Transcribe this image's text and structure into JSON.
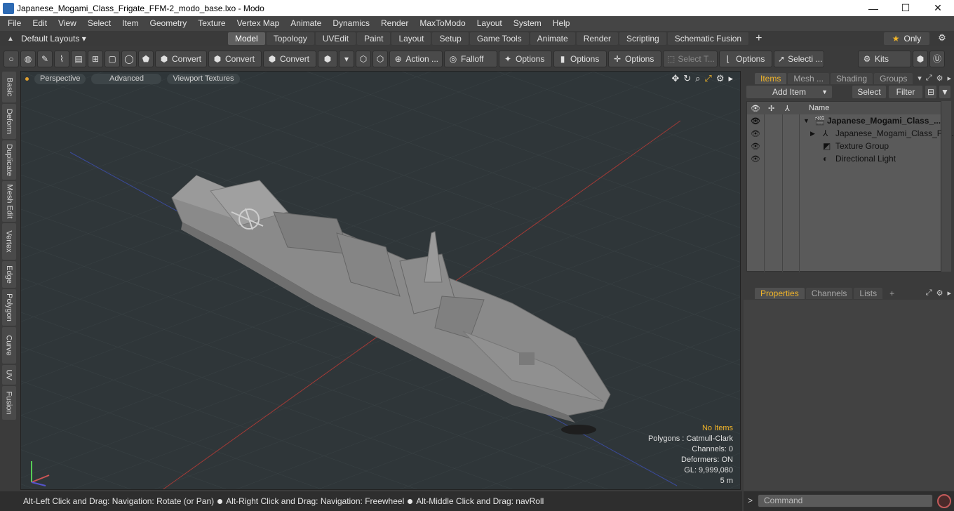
{
  "window": {
    "title": "Japanese_Mogami_Class_Frigate_FFM-2_modo_base.lxo - Modo",
    "min": "—",
    "max": "☐",
    "close": "✕"
  },
  "menu": [
    "File",
    "Edit",
    "View",
    "Select",
    "Item",
    "Geometry",
    "Texture",
    "Vertex Map",
    "Animate",
    "Dynamics",
    "Render",
    "MaxToModo",
    "Layout",
    "System",
    "Help"
  ],
  "layouts": {
    "dropdown": "Default Layouts ▾",
    "tabs": [
      "Model",
      "Topology",
      "UVEdit",
      "Paint",
      "Layout",
      "Setup",
      "Game Tools",
      "Animate",
      "Render",
      "Scripting",
      "Schematic Fusion"
    ],
    "active": "Model",
    "plus": "+",
    "only": "Only"
  },
  "toolbar": {
    "convert1": "Convert",
    "convert2": "Convert",
    "convert3": "Convert",
    "action": "Action ...",
    "falloff": "Falloff",
    "options1": "Options",
    "options2": "Options",
    "options3": "Options",
    "select_t": "Select T...",
    "options4": "Options",
    "selecti": "Selecti ...",
    "kits": "Kits"
  },
  "left_tabs": [
    "Basic",
    "Deform",
    "Duplicate",
    "Mesh Edit",
    "Vertex",
    "Edge",
    "Polygon",
    "Curve",
    "UV",
    "Fusion"
  ],
  "viewport": {
    "perspective": "Perspective",
    "advanced": "Advanced",
    "textures": "Viewport Textures",
    "info": {
      "no_items": "No Items",
      "polygons": "Polygons : Catmull-Clark",
      "channels": "Channels: 0",
      "deformers": "Deformers: ON",
      "gl": "GL: 9,999,080",
      "scale": "5 m"
    }
  },
  "status": {
    "part1": "Alt-Left Click and Drag: Navigation: Rotate (or Pan)",
    "part2": "Alt-Right Click and Drag: Navigation: Freewheel",
    "part3": "Alt-Middle Click and Drag: navRoll"
  },
  "items_panel": {
    "tabs": [
      "Items",
      "Mesh ...",
      "Shading",
      "Groups"
    ],
    "add_item": "Add Item",
    "select": "Select",
    "filter": "Filter",
    "name_col": "Name",
    "rows": [
      {
        "label": "Japanese_Mogami_Class_..."
      },
      {
        "label": "Japanese_Mogami_Class_Fri..."
      },
      {
        "label": "Texture Group"
      },
      {
        "label": "Directional Light"
      }
    ]
  },
  "props_panel": {
    "tabs": [
      "Properties",
      "Channels",
      "Lists"
    ],
    "plus": "+"
  },
  "command": {
    "placeholder": "Command"
  },
  "colors": {
    "accent": "#f0b429",
    "viewport_bg": "#2f3639"
  }
}
